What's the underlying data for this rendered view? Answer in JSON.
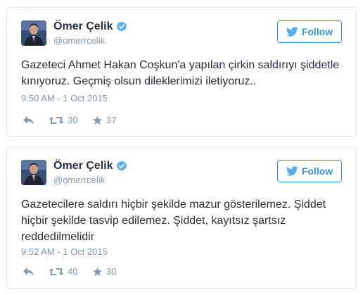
{
  "colors": {
    "accent": "#55acee",
    "follow_border": "#3b94d9",
    "name_text": "#292f33",
    "muted_text": "#8899a6",
    "card_border": "#e1e8ed"
  },
  "tweets": [
    {
      "author": {
        "display_name": "Ömer Çelik",
        "screen_name": "@omerrcelik",
        "verified": true
      },
      "follow_label": "Follow",
      "text": "Gazeteci Ahmet Hakan Coşkun'a yapılan çirkin saldırıyı şiddetle kınıyoruz. Geçmiş olsun dileklerimizi iletiyoruz..",
      "timestamp": "9:50 AM - 1 Oct 2015",
      "retweets": "30",
      "favorites": "37",
      "icons": [
        "verified-icon",
        "bird-icon",
        "reply-icon",
        "retweet-icon",
        "star-icon"
      ]
    },
    {
      "author": {
        "display_name": "Ömer Çelik",
        "screen_name": "@omerrcelik",
        "verified": true
      },
      "follow_label": "Follow",
      "text": "Gazetecilere saldırı hiçbir şekilde mazur gösterilemez. Şiddet hiçbir şekilde tasvip edilemez. Şiddet, kayıtsız şartsız reddedilmelidir",
      "timestamp": "9:52 AM - 1 Oct 2015",
      "retweets": "40",
      "favorites": "30",
      "icons": [
        "verified-icon",
        "bird-icon",
        "reply-icon",
        "retweet-icon",
        "star-icon"
      ]
    }
  ]
}
